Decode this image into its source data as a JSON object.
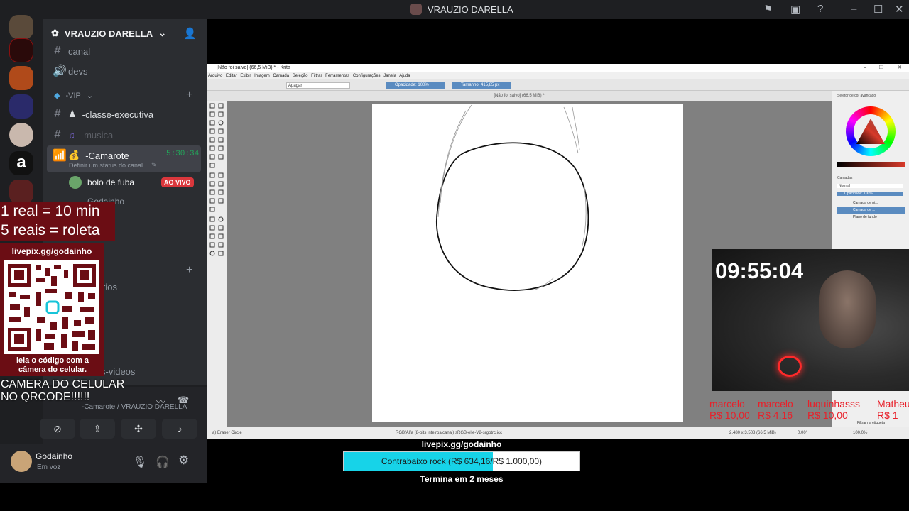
{
  "titlebar": {
    "title": "VRAUZIO DARELLA"
  },
  "server": {
    "name": "VRAUZIO DARELLA"
  },
  "channels": {
    "canal": "canal",
    "devs": "devs",
    "category_vip": "-VIP",
    "classe_executiva": "-classe-executiva",
    "musica": "-musica",
    "camarote": "-Camarote",
    "camarote_timer": "5:30:34",
    "status_placeholder": "Definir um status do canal",
    "live_user": "bolo de fuba",
    "live_badge": "AO VIVO",
    "user2": "Godainho",
    "partial_rios": "rios",
    "partial_l": "l",
    "partial_videos": "s-videos"
  },
  "voice_panel": {
    "channel_path": "-Camarote / VRAUZIO DARELLA",
    "username": "Godainho",
    "status": "Em voz"
  },
  "overlay": {
    "price_line1": "1 real = 10 min",
    "price_line2": "5 reais = roleta",
    "livepix_link": "livepix.gg/godainho",
    "qr_caption": "leia o código com a câmera do celular.",
    "camera_notice_line1": "CAMERA DO CELULAR",
    "camera_notice_line2": "NO QRCODE!!!!!!"
  },
  "krita": {
    "window_title": "[Não foi salvo] (66,5 MiB) * - Krita",
    "menu": [
      "Arquivo",
      "Editar",
      "Exibir",
      "Imagem",
      "Camada",
      "Seleção",
      "Filtrar",
      "Ferramentas",
      "Configurações",
      "Janela",
      "Ajuda"
    ],
    "blend_mode": "Apagar",
    "opacity": "Opacidade: 100%",
    "size": "Tamanho: 415,85 px",
    "tab_label": "[Não foi salvo] (66,5 MiB) *",
    "docker_color": "Seletor de cor avançado",
    "docker_layers": "Camadas",
    "layer_mode": "Normal",
    "layer_opacity": "Opacidade: 100%",
    "layers": [
      "Camada de pi...",
      "Camada de ...",
      "Plano de fundo"
    ],
    "status_brush": "a) Eraser Circle",
    "status_color": "RGB/Alfa (8-bits inteiros/canal)  sRGB-elle-V2-srgbtrc.icc",
    "status_dims": "2.480 x 3.508 (66,5 MiB)",
    "status_zoom": "100,0%",
    "status_rotation": "0,00°",
    "filter_label": "Filtrar na etiqueta"
  },
  "webcam": {
    "clock": "09:55:04"
  },
  "donations": [
    {
      "name": "marcelo",
      "amount": "R$ 10,00"
    },
    {
      "name": "marcelo",
      "amount": "R$ 4,16"
    },
    {
      "name": "luquinhasss",
      "amount": "R$ 10,00"
    },
    {
      "name": "Matheu",
      "amount": "R$ 1"
    }
  ],
  "goal": {
    "link": "livepix.gg/godainho",
    "label": "Contrabaixo rock (R$ 634,16/R$ 1.000,00)",
    "progress": 0.634,
    "ends": "Termina em 2 meses",
    "fill_color": "#17d3e8"
  }
}
